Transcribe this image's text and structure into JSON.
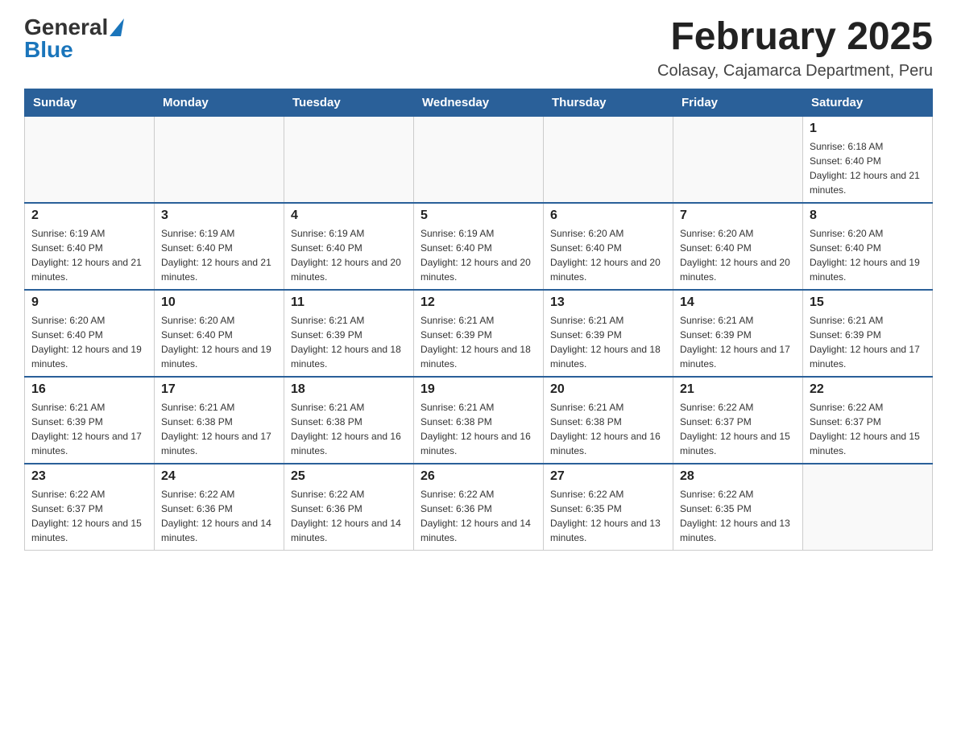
{
  "header": {
    "logo_general": "General",
    "logo_blue": "Blue",
    "month_title": "February 2025",
    "location": "Colasay, Cajamarca Department, Peru"
  },
  "days_of_week": [
    "Sunday",
    "Monday",
    "Tuesday",
    "Wednesday",
    "Thursday",
    "Friday",
    "Saturday"
  ],
  "weeks": [
    [
      {
        "day": "",
        "info": ""
      },
      {
        "day": "",
        "info": ""
      },
      {
        "day": "",
        "info": ""
      },
      {
        "day": "",
        "info": ""
      },
      {
        "day": "",
        "info": ""
      },
      {
        "day": "",
        "info": ""
      },
      {
        "day": "1",
        "info": "Sunrise: 6:18 AM\nSunset: 6:40 PM\nDaylight: 12 hours and 21 minutes."
      }
    ],
    [
      {
        "day": "2",
        "info": "Sunrise: 6:19 AM\nSunset: 6:40 PM\nDaylight: 12 hours and 21 minutes."
      },
      {
        "day": "3",
        "info": "Sunrise: 6:19 AM\nSunset: 6:40 PM\nDaylight: 12 hours and 21 minutes."
      },
      {
        "day": "4",
        "info": "Sunrise: 6:19 AM\nSunset: 6:40 PM\nDaylight: 12 hours and 20 minutes."
      },
      {
        "day": "5",
        "info": "Sunrise: 6:19 AM\nSunset: 6:40 PM\nDaylight: 12 hours and 20 minutes."
      },
      {
        "day": "6",
        "info": "Sunrise: 6:20 AM\nSunset: 6:40 PM\nDaylight: 12 hours and 20 minutes."
      },
      {
        "day": "7",
        "info": "Sunrise: 6:20 AM\nSunset: 6:40 PM\nDaylight: 12 hours and 20 minutes."
      },
      {
        "day": "8",
        "info": "Sunrise: 6:20 AM\nSunset: 6:40 PM\nDaylight: 12 hours and 19 minutes."
      }
    ],
    [
      {
        "day": "9",
        "info": "Sunrise: 6:20 AM\nSunset: 6:40 PM\nDaylight: 12 hours and 19 minutes."
      },
      {
        "day": "10",
        "info": "Sunrise: 6:20 AM\nSunset: 6:40 PM\nDaylight: 12 hours and 19 minutes."
      },
      {
        "day": "11",
        "info": "Sunrise: 6:21 AM\nSunset: 6:39 PM\nDaylight: 12 hours and 18 minutes."
      },
      {
        "day": "12",
        "info": "Sunrise: 6:21 AM\nSunset: 6:39 PM\nDaylight: 12 hours and 18 minutes."
      },
      {
        "day": "13",
        "info": "Sunrise: 6:21 AM\nSunset: 6:39 PM\nDaylight: 12 hours and 18 minutes."
      },
      {
        "day": "14",
        "info": "Sunrise: 6:21 AM\nSunset: 6:39 PM\nDaylight: 12 hours and 17 minutes."
      },
      {
        "day": "15",
        "info": "Sunrise: 6:21 AM\nSunset: 6:39 PM\nDaylight: 12 hours and 17 minutes."
      }
    ],
    [
      {
        "day": "16",
        "info": "Sunrise: 6:21 AM\nSunset: 6:39 PM\nDaylight: 12 hours and 17 minutes."
      },
      {
        "day": "17",
        "info": "Sunrise: 6:21 AM\nSunset: 6:38 PM\nDaylight: 12 hours and 17 minutes."
      },
      {
        "day": "18",
        "info": "Sunrise: 6:21 AM\nSunset: 6:38 PM\nDaylight: 12 hours and 16 minutes."
      },
      {
        "day": "19",
        "info": "Sunrise: 6:21 AM\nSunset: 6:38 PM\nDaylight: 12 hours and 16 minutes."
      },
      {
        "day": "20",
        "info": "Sunrise: 6:21 AM\nSunset: 6:38 PM\nDaylight: 12 hours and 16 minutes."
      },
      {
        "day": "21",
        "info": "Sunrise: 6:22 AM\nSunset: 6:37 PM\nDaylight: 12 hours and 15 minutes."
      },
      {
        "day": "22",
        "info": "Sunrise: 6:22 AM\nSunset: 6:37 PM\nDaylight: 12 hours and 15 minutes."
      }
    ],
    [
      {
        "day": "23",
        "info": "Sunrise: 6:22 AM\nSunset: 6:37 PM\nDaylight: 12 hours and 15 minutes."
      },
      {
        "day": "24",
        "info": "Sunrise: 6:22 AM\nSunset: 6:36 PM\nDaylight: 12 hours and 14 minutes."
      },
      {
        "day": "25",
        "info": "Sunrise: 6:22 AM\nSunset: 6:36 PM\nDaylight: 12 hours and 14 minutes."
      },
      {
        "day": "26",
        "info": "Sunrise: 6:22 AM\nSunset: 6:36 PM\nDaylight: 12 hours and 14 minutes."
      },
      {
        "day": "27",
        "info": "Sunrise: 6:22 AM\nSunset: 6:35 PM\nDaylight: 12 hours and 13 minutes."
      },
      {
        "day": "28",
        "info": "Sunrise: 6:22 AM\nSunset: 6:35 PM\nDaylight: 12 hours and 13 minutes."
      },
      {
        "day": "",
        "info": ""
      }
    ]
  ]
}
